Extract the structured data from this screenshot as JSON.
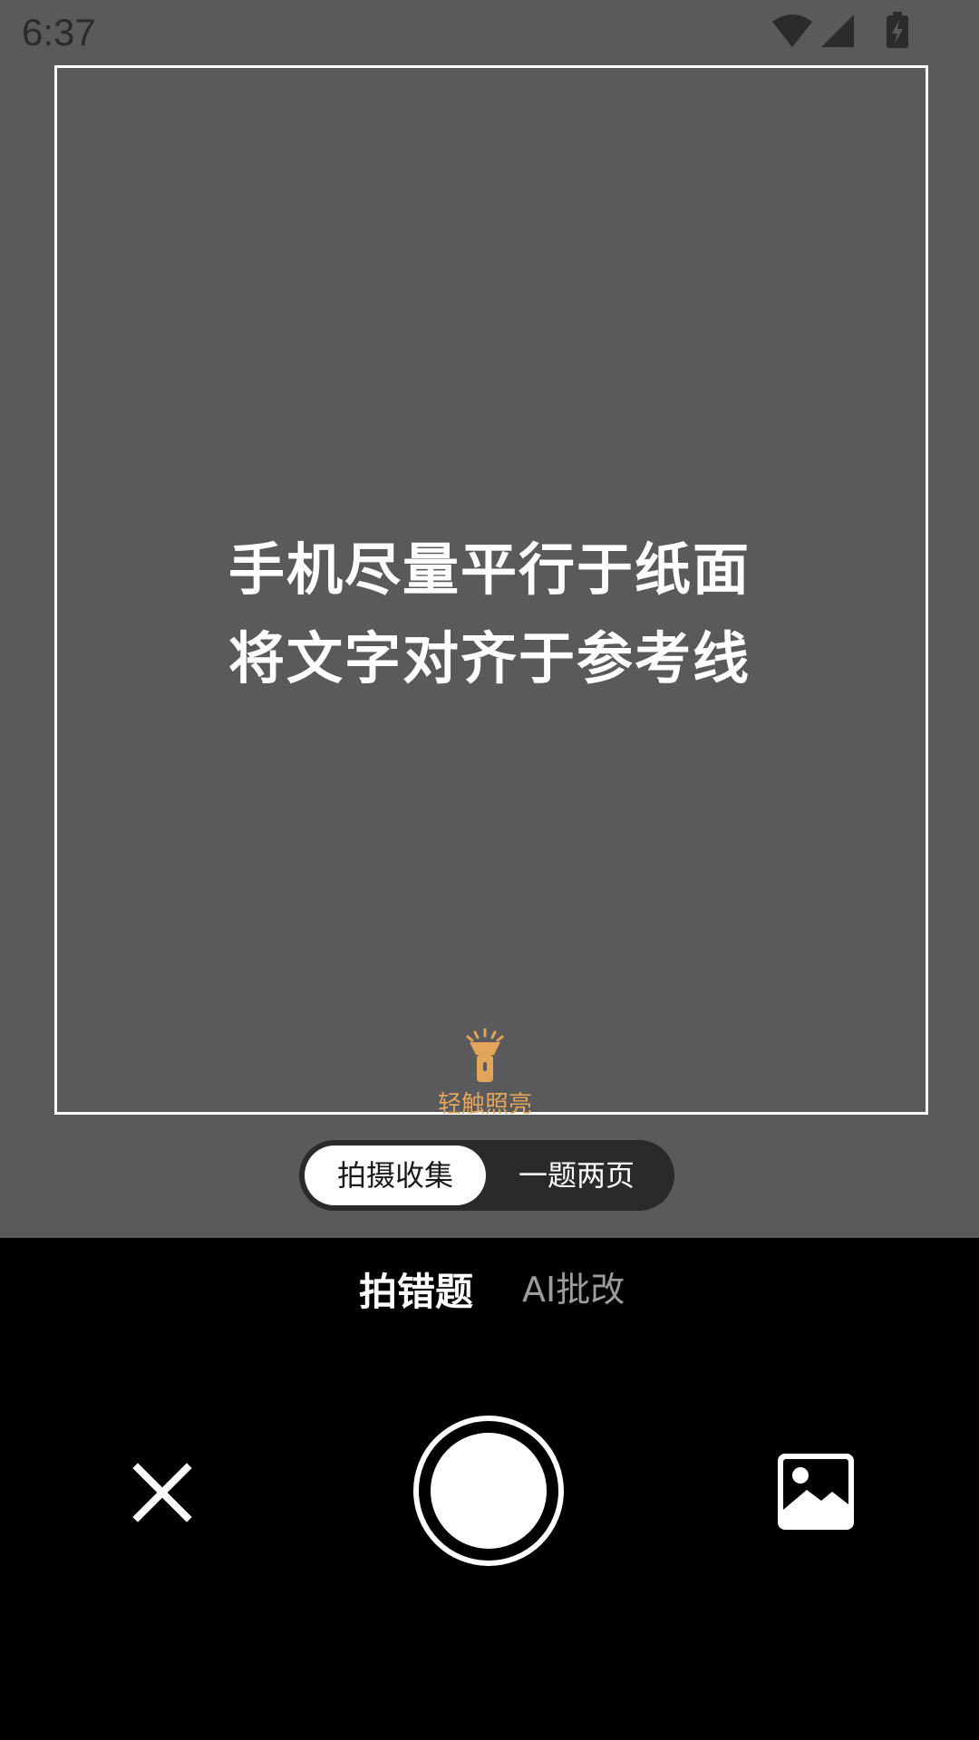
{
  "status_bar": {
    "time": "6:37",
    "icons": [
      "wifi-icon",
      "signal-icon",
      "battery-charging-icon"
    ]
  },
  "camera": {
    "hint_line_1": "手机尽量平行于纸面",
    "hint_line_2": "将文字对齐于参考线",
    "torch_label": "轻触照亮",
    "torch_icon": "flashlight-icon"
  },
  "mode_toggle": {
    "options": [
      {
        "label": "拍摄收集",
        "selected": true
      },
      {
        "label": "一题两页",
        "selected": false
      }
    ]
  },
  "tabs": [
    {
      "label": "拍错题",
      "active": true
    },
    {
      "label": "AI批改",
      "active": false
    }
  ],
  "controls": {
    "close_icon": "close-icon",
    "shutter_icon": "shutter-button",
    "gallery_icon": "gallery-icon"
  },
  "colors": {
    "viewfinder_bg": "#5a595b",
    "accent_torch": "#e2a55a",
    "bottom_bg": "#000000"
  }
}
